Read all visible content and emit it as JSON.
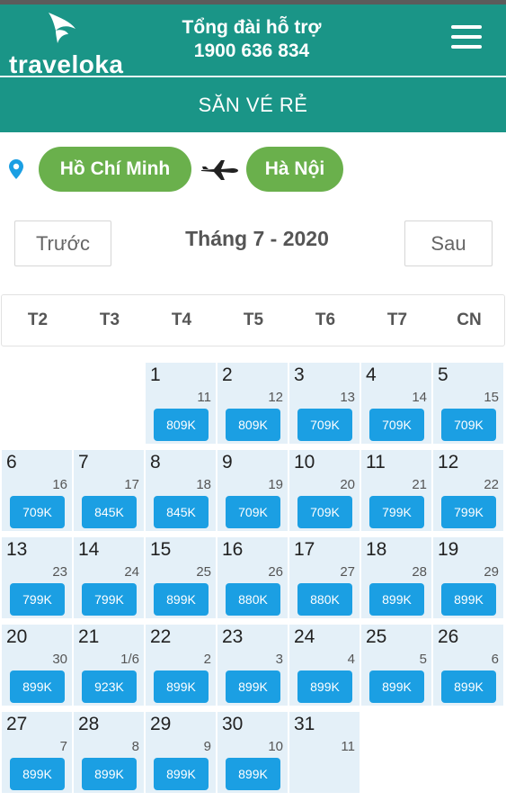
{
  "header": {
    "logo_text": "traveloka",
    "hotline_title": "Tổng đài hỗ trợ",
    "hotline_number": "1900 636 834",
    "subtitle": "SĂN VÉ RẺ"
  },
  "route": {
    "from": "Hồ Chí Minh",
    "to": "Hà Nội"
  },
  "month_nav": {
    "prev_label": "Trước",
    "title": "Tháng 7 - 2020",
    "next_label": "Sau"
  },
  "weekdays": [
    "T2",
    "T3",
    "T4",
    "T5",
    "T6",
    "T7",
    "CN"
  ],
  "colors": {
    "header_bg": "#1a9587",
    "city_pill": "#6ab04c",
    "price_button": "#1b9fe3",
    "cell_bg": "#e4f0f8"
  },
  "calendar": [
    {
      "day": "1",
      "lunar": "11",
      "price": "809K"
    },
    {
      "day": "2",
      "lunar": "12",
      "price": "809K"
    },
    {
      "day": "3",
      "lunar": "13",
      "price": "709K"
    },
    {
      "day": "4",
      "lunar": "14",
      "price": "709K"
    },
    {
      "day": "5",
      "lunar": "15",
      "price": "709K"
    },
    {
      "day": "6",
      "lunar": "16",
      "price": "709K"
    },
    {
      "day": "7",
      "lunar": "17",
      "price": "845K"
    },
    {
      "day": "8",
      "lunar": "18",
      "price": "845K"
    },
    {
      "day": "9",
      "lunar": "19",
      "price": "709K"
    },
    {
      "day": "10",
      "lunar": "20",
      "price": "709K"
    },
    {
      "day": "11",
      "lunar": "21",
      "price": "799K"
    },
    {
      "day": "12",
      "lunar": "22",
      "price": "799K"
    },
    {
      "day": "13",
      "lunar": "23",
      "price": "799K"
    },
    {
      "day": "14",
      "lunar": "24",
      "price": "799K"
    },
    {
      "day": "15",
      "lunar": "25",
      "price": "899K"
    },
    {
      "day": "16",
      "lunar": "26",
      "price": "880K"
    },
    {
      "day": "17",
      "lunar": "27",
      "price": "880K"
    },
    {
      "day": "18",
      "lunar": "28",
      "price": "899K"
    },
    {
      "day": "19",
      "lunar": "29",
      "price": "899K"
    },
    {
      "day": "20",
      "lunar": "30",
      "price": "899K"
    },
    {
      "day": "21",
      "lunar": "1/6",
      "price": "923K"
    },
    {
      "day": "22",
      "lunar": "2",
      "price": "899K"
    },
    {
      "day": "23",
      "lunar": "3",
      "price": "899K"
    },
    {
      "day": "24",
      "lunar": "4",
      "price": "899K"
    },
    {
      "day": "25",
      "lunar": "5",
      "price": "899K"
    },
    {
      "day": "26",
      "lunar": "6",
      "price": "899K"
    },
    {
      "day": "27",
      "lunar": "7",
      "price": "899K"
    },
    {
      "day": "28",
      "lunar": "8",
      "price": "899K"
    },
    {
      "day": "29",
      "lunar": "9",
      "price": "899K"
    },
    {
      "day": "30",
      "lunar": "10",
      "price": "899K"
    },
    {
      "day": "31",
      "lunar": "11",
      "price": ""
    }
  ]
}
